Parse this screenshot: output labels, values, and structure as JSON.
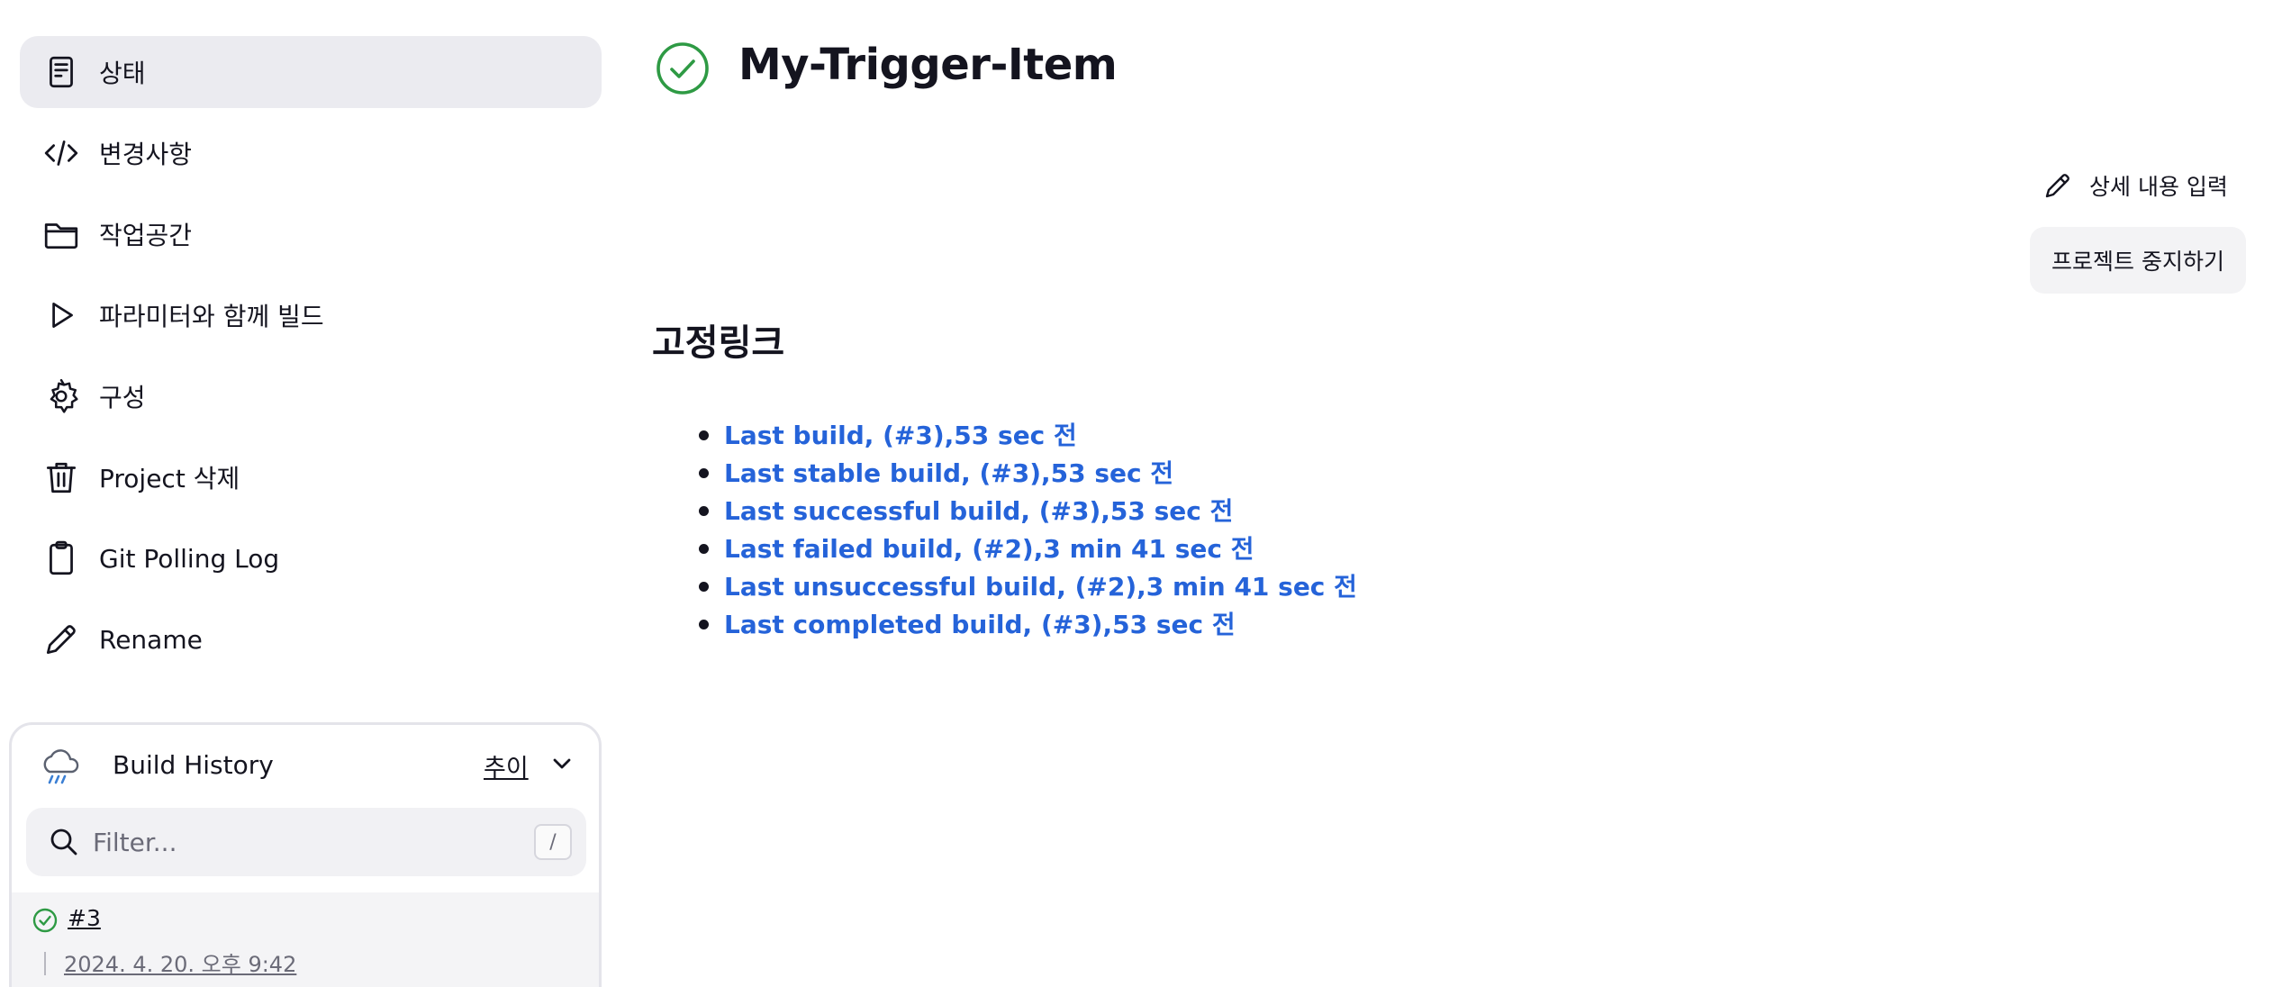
{
  "sidebar": {
    "items": [
      {
        "label": "상태",
        "icon": "document-icon",
        "active": true
      },
      {
        "label": "변경사항",
        "icon": "code-icon"
      },
      {
        "label": "작업공간",
        "icon": "folder-icon"
      },
      {
        "label": "파라미터와 함께 빌드",
        "icon": "play-icon"
      },
      {
        "label": "구성",
        "icon": "gear-icon"
      },
      {
        "label": "Project 삭제",
        "icon": "trash-icon"
      },
      {
        "label": "Git Polling Log",
        "icon": "clipboard-icon"
      },
      {
        "label": "Rename",
        "icon": "pencil-icon"
      }
    ]
  },
  "build_history": {
    "title": "Build History",
    "trend_label": "추이",
    "filter_placeholder": "Filter...",
    "shortcut": "/",
    "builds": [
      {
        "number": "#3",
        "date": "2024. 4. 20. 오후 9:42",
        "status": "success"
      }
    ]
  },
  "header": {
    "title": "My-Trigger-Item",
    "status": "success"
  },
  "actions": {
    "edit_description": "상세 내용 입력",
    "disable_project": "프로젝트 중지하기"
  },
  "permalinks": {
    "title": "고정링크",
    "items": [
      "Last build, (#3),53 sec 전",
      "Last stable build, (#3),53 sec 전",
      "Last successful build, (#3),53 sec 전",
      "Last failed build, (#2),3 min 41 sec 전",
      "Last unsuccessful build, (#2),3 min 41 sec 전",
      "Last completed build, (#3),53 sec 전"
    ]
  },
  "colors": {
    "success": "#2e9a44",
    "link": "#2563d9",
    "active_bg": "#ebebf0"
  }
}
